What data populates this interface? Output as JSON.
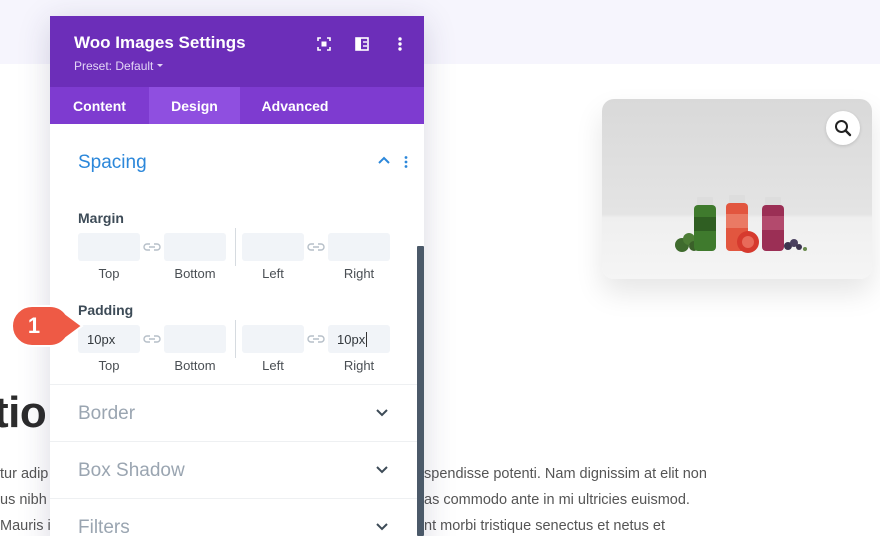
{
  "modal": {
    "title": "Woo Images Settings",
    "preset": "Preset: Default",
    "tabs": [
      {
        "label": "Content"
      },
      {
        "label": "Design"
      },
      {
        "label": "Advanced"
      }
    ],
    "active_tab": "Design"
  },
  "spacing": {
    "title": "Spacing",
    "margin": {
      "label": "Margin",
      "fields": [
        {
          "sub": "Top",
          "value": ""
        },
        {
          "sub": "Bottom",
          "value": ""
        },
        {
          "sub": "Left",
          "value": ""
        },
        {
          "sub": "Right",
          "value": ""
        }
      ]
    },
    "padding": {
      "label": "Padding",
      "fields": [
        {
          "sub": "Top",
          "value": "10px"
        },
        {
          "sub": "Bottom",
          "value": ""
        },
        {
          "sub": "Left",
          "value": ""
        },
        {
          "sub": "Right",
          "value": "10px"
        }
      ]
    }
  },
  "sections": [
    {
      "label": "Border"
    },
    {
      "label": "Box Shadow"
    },
    {
      "label": "Filters"
    }
  ],
  "callout": {
    "number": "1"
  },
  "background": {
    "heading_fragment": "tio",
    "lines": [
      {
        "left": "tur adip",
        "right": "spendisse potenti. Nam dignissim at elit non"
      },
      {
        "left": "us nibh",
        "right": "as commodo ante in mi ultricies euismod."
      },
      {
        "left": "Mauris i",
        "right": "nt morbi tristique senectus et netus et"
      }
    ]
  },
  "colors": {
    "header": "#6c2eb9",
    "tabs": "#7e3bd0",
    "active_tab": "#8f4fe0",
    "accent_blue": "#2b87da",
    "callout": "#ee5a45"
  }
}
